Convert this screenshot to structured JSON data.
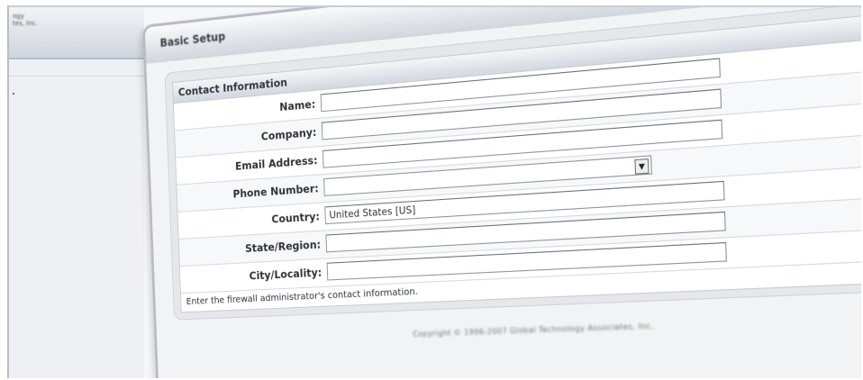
{
  "sidebar": {
    "org_text_line1": "ogy",
    "org_text_line2": "tes, Inc."
  },
  "window": {
    "title": "Basic Setup",
    "close_icon": "close-icon",
    "next_icon": "next-arrow-icon"
  },
  "section": {
    "title": "Contact Information"
  },
  "fields": [
    {
      "label": "Name:",
      "value": ""
    },
    {
      "label": "Company:",
      "value": ""
    },
    {
      "label": "Email Address:",
      "value": ""
    },
    {
      "label": "Phone Number:",
      "value": ""
    },
    {
      "label": "Country:",
      "value": "United States [US]"
    },
    {
      "label": "State/Region:",
      "value": ""
    },
    {
      "label": "City/Locality:",
      "value": ""
    }
  ],
  "hint": "Enter the firewall administrator's contact information.",
  "footer": {
    "copyright": "Copyright © 1996-2007 Global Technology Associates, Inc."
  },
  "colors": {
    "accent_green": "#59b63f",
    "close_red": "#d64a2e"
  }
}
